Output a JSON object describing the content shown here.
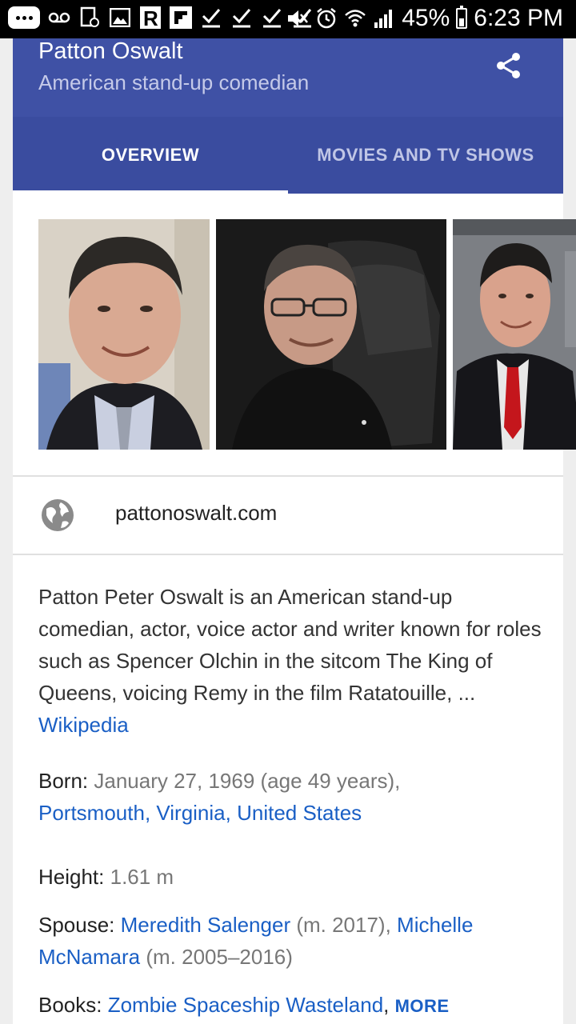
{
  "status_bar": {
    "battery": "45%",
    "time": "6:23 PM"
  },
  "header": {
    "title": "Patton Oswalt",
    "subtitle": "American stand-up comedian"
  },
  "tabs": [
    {
      "label": "OVERVIEW",
      "active": true
    },
    {
      "label": "MOVIES AND TV SHOWS",
      "active": false
    }
  ],
  "website": "pattonoswalt.com",
  "description": {
    "text": "Patton Peter Oswalt is an American stand-up comedian, actor, voice actor and writer known for roles such as Spencer Olchin in the sitcom The King of Queens, voicing Remy in the film Ratatouille, ... ",
    "source_link": "Wikipedia"
  },
  "facts": {
    "born_label": "Born: ",
    "born_value": "January 27, 1969 (age 49 years),",
    "born_place": "Portsmouth, Virginia, United States",
    "height_label": "Height: ",
    "height_value": "1.61 m",
    "spouse_label": "Spouse: ",
    "spouse1": "Meredith Salenger",
    "spouse1_dates": " (m. 2017), ",
    "spouse2": "Michelle McNamara",
    "spouse2_dates": " (m. 2005–2016)",
    "books_label": "Books: ",
    "book1": "Zombie Spaceship Wasteland",
    "books_sep": ", ",
    "more_label": "MORE"
  },
  "colors": {
    "header": "#3f51a5",
    "tabs": "#3a4c9f",
    "link": "#1a5fc5"
  }
}
